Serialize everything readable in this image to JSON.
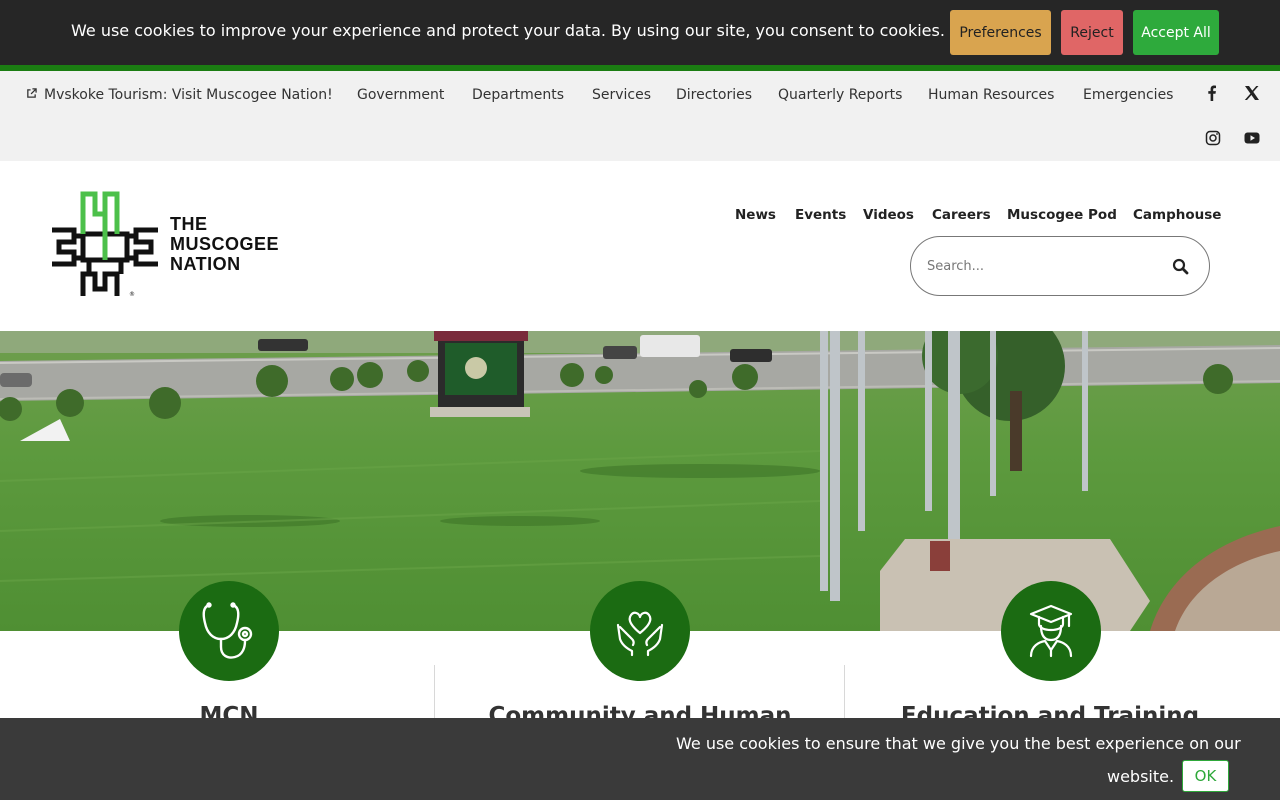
{
  "cookie_top": {
    "message": "We use cookies to improve your experience and protect your data. By using our site, you consent to cookies.",
    "preferences_label": "Preferences",
    "reject_label": "Reject",
    "accept_label": "Accept All"
  },
  "utility_nav": {
    "tourism_label": "Mvskoke Tourism: Visit Muscogee Nation!",
    "items": [
      "Government",
      "Departments",
      "Services",
      "Directories",
      "Quarterly Reports",
      "Human Resources",
      "Emergencies"
    ],
    "social_icons": [
      "facebook-icon",
      "x-icon",
      "instagram-icon",
      "youtube-icon"
    ]
  },
  "header": {
    "logo_lines": [
      "THE",
      "MUSCOGEE",
      "NATION"
    ],
    "main_nav": [
      "News",
      "Events",
      "Videos",
      "Careers",
      "Muscogee Pod",
      "Camphouse"
    ],
    "search_placeholder": "Search..."
  },
  "cards": [
    {
      "title": "MCN",
      "icon": "stethoscope-icon"
    },
    {
      "title": "Community and Human",
      "icon": "heart-hands-icon"
    },
    {
      "title": "Education and Training",
      "icon": "graduate-icon"
    }
  ],
  "cookie_bottom": {
    "line1": "We use cookies to ensure that we give you the best experience on our",
    "line2": "website.",
    "ok_label": "OK"
  },
  "colors": {
    "brand_green": "#1b6b12",
    "cookie_bg": "#262626",
    "accept": "#2eaa3c",
    "reject": "#e06666",
    "preferences": "#d9a44f"
  }
}
